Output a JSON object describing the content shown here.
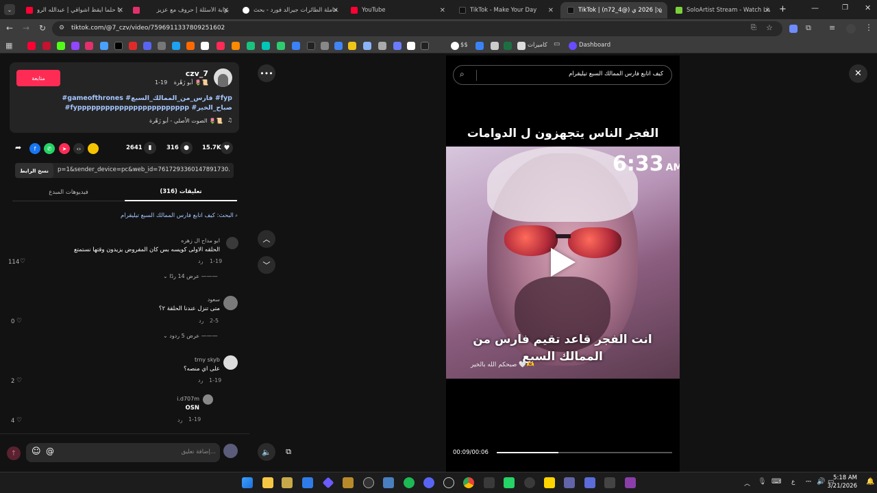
{
  "browser": {
    "tabs": [
      {
        "title": "يا حلماً أيقظ أشواقي | عبدالله الرو...",
        "color": "#ff0033"
      },
      {
        "title": "",
        "color": "#e0306d"
      },
      {
        "title": "بوابة الأسئلة | حروف مع عزيز",
        "color": "#000000"
      },
      {
        "title": "حاملة الطائرات جيرالد فورد - بحث...",
        "color": "#ffffff"
      },
      {
        "title": "YouTube",
        "color": "#ff0033"
      },
      {
        "title": "TikTok - Make Your Day",
        "color": "#111111"
      },
      {
        "title": "TikTok | (n72_4@) ندى | 2026 ي...",
        "color": "#111111"
      },
      {
        "title": "SoloArtist Stream - Watch Live",
        "color": "#7bd13a"
      }
    ],
    "url": "tiktok.com/@7_czv/video/7596911337809251602",
    "bookmarks": {
      "cameras_label": "كاميرات",
      "dashboard_label": "Dashboard",
      "dollar_label": "$$"
    }
  },
  "post": {
    "follow_label": "متابعة",
    "username": "czv_7",
    "nickname": "أبو زَهْرة 🌷📜",
    "date": "1-19",
    "hashtags_line1": "#gameofthrones #فارس_من_الممالك_السبع #fyp",
    "hashtags_line2": "#fypppppppppppppppppppppppp #صباح_الخير",
    "sound": "الصوت الأصلي - أبو زَهْرة 🌷📜",
    "likes": "15.7K",
    "comments": "316",
    "saves": "2641",
    "link": "p=1&sender_device=pc&web_id=7617293360147891730...",
    "copy_link_label": "نسخ الرابط"
  },
  "tabs": {
    "comments_label": "تعليقات (316)",
    "creator_videos_label": "فيديوهات المبدع"
  },
  "search_hint": "البحث: كيف اتابع فارس الممالك السبع تيليقرام",
  "comments": [
    {
      "name": "ابو مداح ال زهره",
      "text": "الحلقه الاولى كويسه بس كان المفروض يزيدون وقتها نستمتع",
      "date": "1-19",
      "reply": "رد",
      "likes": "114",
      "more": "عرض 14 ردًا"
    },
    {
      "name": "سعود",
      "text": "متى تنزل عندنا الحلقة ٢؟",
      "date": "2-5",
      "reply": "رد",
      "likes": "0",
      "more": "عرض 5 ردود"
    },
    {
      "name": "trny skyb",
      "text": "على اي منصه؟",
      "date": "1-19",
      "reply": "رد",
      "likes": "2",
      "more": ""
    },
    {
      "name": "i.d707m",
      "text": "OSN",
      "date": "1-19",
      "reply": "رد",
      "likes": "4",
      "more": ""
    }
  ],
  "comment_input_placeholder": "إضافة تعليق...",
  "video": {
    "search_text": "كيف اتابع فارس الممالك السبع تيليقرام",
    "caption_top": "الفجر الناس يتجهزون ل الدوامات",
    "clock": "6:33",
    "clock_ampm": "AM",
    "caption_bottom": "انت الفجر قاعد تقيم فارس من الممالك السبع",
    "watermark": "صبحكم الله بالخير 🤍🫶",
    "time": "00:09/00:06",
    "progress": 0.35
  },
  "taskbar": {
    "time": "5:18 AM",
    "date": "3/21/2026",
    "lang": "ع"
  }
}
